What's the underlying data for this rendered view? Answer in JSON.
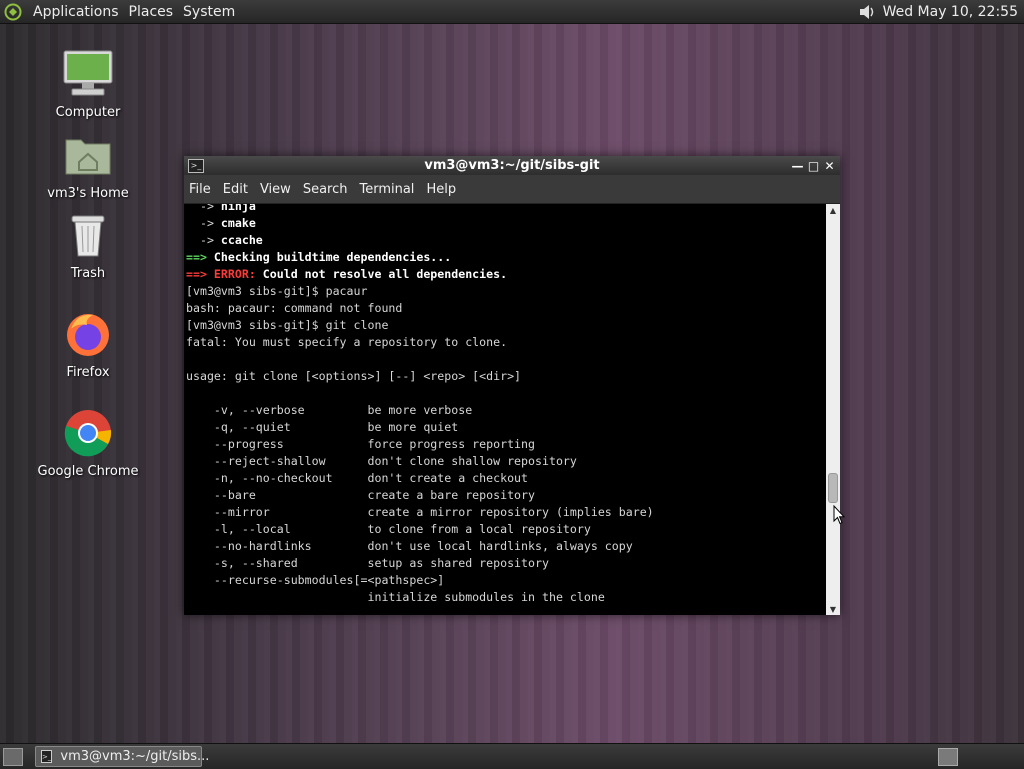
{
  "top_panel": {
    "menu": [
      "Applications",
      "Places",
      "System"
    ],
    "clock": "Wed May 10, 22:55",
    "icons": {
      "logo": "distro-logo-icon",
      "volume": "speaker-icon"
    }
  },
  "desktop_icons": [
    {
      "label": "Computer",
      "icon": "computer-icon"
    },
    {
      "label": "vm3's Home",
      "icon": "home-folder-icon"
    },
    {
      "label": "Trash",
      "icon": "trash-icon"
    },
    {
      "label": "Firefox",
      "icon": "firefox-icon"
    },
    {
      "label": "Google Chrome",
      "icon": "chrome-icon"
    }
  ],
  "terminal": {
    "title": "vm3@vm3:~/git/sibs-git",
    "menu": [
      "File",
      "Edit",
      "View",
      "Search",
      "Terminal",
      "Help"
    ],
    "lines": [
      {
        "segments": [
          {
            "t": "  -> ",
            "c": "plain"
          },
          {
            "t": "ninja",
            "c": "bold"
          }
        ]
      },
      {
        "segments": [
          {
            "t": "  -> ",
            "c": "plain"
          },
          {
            "t": "cmake",
            "c": "bold"
          }
        ]
      },
      {
        "segments": [
          {
            "t": "  -> ",
            "c": "plain"
          },
          {
            "t": "ccache",
            "c": "bold"
          }
        ]
      },
      {
        "segments": [
          {
            "t": "==> ",
            "c": "green"
          },
          {
            "t": "Checking buildtime dependencies...",
            "c": "bold"
          }
        ]
      },
      {
        "segments": [
          {
            "t": "==> ERROR: ",
            "c": "red"
          },
          {
            "t": "Could not resolve all dependencies.",
            "c": "bold"
          }
        ]
      },
      {
        "segments": [
          {
            "t": "[vm3@vm3 sibs-git]$ pacaur",
            "c": "plain"
          }
        ]
      },
      {
        "segments": [
          {
            "t": "bash: pacaur: command not found",
            "c": "plain"
          }
        ]
      },
      {
        "segments": [
          {
            "t": "[vm3@vm3 sibs-git]$ git clone",
            "c": "plain"
          }
        ]
      },
      {
        "segments": [
          {
            "t": "fatal: You must specify a repository to clone.",
            "c": "plain"
          }
        ]
      },
      {
        "segments": [
          {
            "t": "",
            "c": "plain"
          }
        ]
      },
      {
        "segments": [
          {
            "t": "usage: git clone [<options>] [--] <repo> [<dir>]",
            "c": "plain"
          }
        ]
      },
      {
        "segments": [
          {
            "t": "",
            "c": "plain"
          }
        ]
      },
      {
        "segments": [
          {
            "t": "    -v, --verbose         be more verbose",
            "c": "plain"
          }
        ]
      },
      {
        "segments": [
          {
            "t": "    -q, --quiet           be more quiet",
            "c": "plain"
          }
        ]
      },
      {
        "segments": [
          {
            "t": "    --progress            force progress reporting",
            "c": "plain"
          }
        ]
      },
      {
        "segments": [
          {
            "t": "    --reject-shallow      don't clone shallow repository",
            "c": "plain"
          }
        ]
      },
      {
        "segments": [
          {
            "t": "    -n, --no-checkout     don't create a checkout",
            "c": "plain"
          }
        ]
      },
      {
        "segments": [
          {
            "t": "    --bare                create a bare repository",
            "c": "plain"
          }
        ]
      },
      {
        "segments": [
          {
            "t": "    --mirror              create a mirror repository (implies bare)",
            "c": "plain"
          }
        ]
      },
      {
        "segments": [
          {
            "t": "    -l, --local           to clone from a local repository",
            "c": "plain"
          }
        ]
      },
      {
        "segments": [
          {
            "t": "    --no-hardlinks        don't use local hardlinks, always copy",
            "c": "plain"
          }
        ]
      },
      {
        "segments": [
          {
            "t": "    -s, --shared          setup as shared repository",
            "c": "plain"
          }
        ]
      },
      {
        "segments": [
          {
            "t": "    --recurse-submodules[=<pathspec>]",
            "c": "plain"
          }
        ]
      },
      {
        "segments": [
          {
            "t": "                          initialize submodules in the clone",
            "c": "plain"
          }
        ]
      }
    ],
    "scroll_position": 0.72
  },
  "bottom_panel": {
    "task_label": "vm3@vm3:~/git/sibs..."
  },
  "colors": {
    "green_prompt": "#5fd75f",
    "error_red": "#ff3a3a",
    "terminal_bg": "#000000"
  }
}
